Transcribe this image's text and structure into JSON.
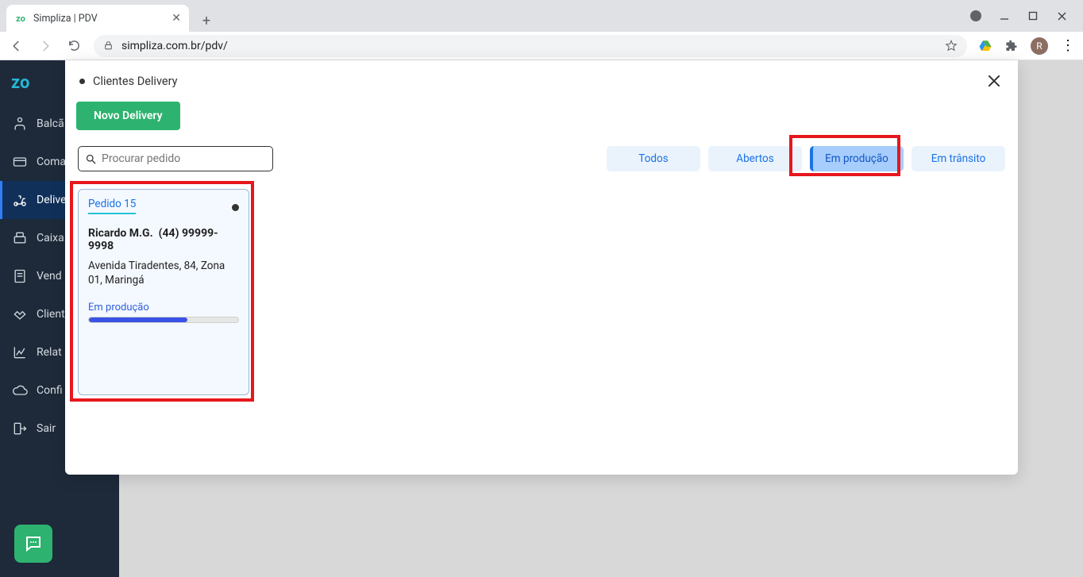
{
  "browser": {
    "tab_title": "Simpliza | PDV",
    "url": "simpliza.com.br/pdv/",
    "avatar_initial": "R"
  },
  "sidebar": {
    "logo": "zo",
    "items": [
      {
        "label": "Balcã"
      },
      {
        "label": "Coma"
      },
      {
        "label": "Delive"
      },
      {
        "label": "Caixa"
      },
      {
        "label": "Vend"
      },
      {
        "label": "Client"
      },
      {
        "label": "Relat"
      },
      {
        "label": "Confi"
      },
      {
        "label": "Sair"
      }
    ]
  },
  "modal": {
    "title": "Clientes Delivery",
    "novo_label": "Novo Delivery",
    "search_placeholder": "Procurar pedido",
    "filters": {
      "todos": "Todos",
      "abertos": "Abertos",
      "em_producao": "Em produção",
      "em_transito": "Em trânsito"
    }
  },
  "order": {
    "title": "Pedido 15",
    "customer_name": "Ricardo M.G.",
    "customer_phone": "(44) 99999-9998",
    "address": "Avenida Tiradentes, 84, Zona 01, Maringá",
    "status_label": "Em produção",
    "progress_pct": 66
  }
}
